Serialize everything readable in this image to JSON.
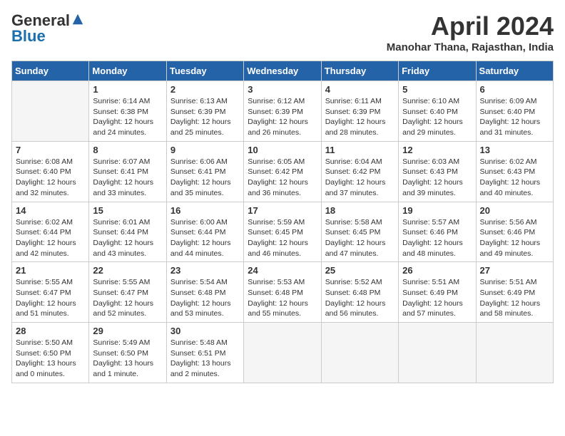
{
  "header": {
    "logo_general": "General",
    "logo_blue": "Blue",
    "month_title": "April 2024",
    "location": "Manohar Thana, Rajasthan, India"
  },
  "weekdays": [
    "Sunday",
    "Monday",
    "Tuesday",
    "Wednesday",
    "Thursday",
    "Friday",
    "Saturday"
  ],
  "weeks": [
    [
      {
        "day": "",
        "content": ""
      },
      {
        "day": "1",
        "content": "Sunrise: 6:14 AM\nSunset: 6:38 PM\nDaylight: 12 hours\nand 24 minutes."
      },
      {
        "day": "2",
        "content": "Sunrise: 6:13 AM\nSunset: 6:39 PM\nDaylight: 12 hours\nand 25 minutes."
      },
      {
        "day": "3",
        "content": "Sunrise: 6:12 AM\nSunset: 6:39 PM\nDaylight: 12 hours\nand 26 minutes."
      },
      {
        "day": "4",
        "content": "Sunrise: 6:11 AM\nSunset: 6:39 PM\nDaylight: 12 hours\nand 28 minutes."
      },
      {
        "day": "5",
        "content": "Sunrise: 6:10 AM\nSunset: 6:40 PM\nDaylight: 12 hours\nand 29 minutes."
      },
      {
        "day": "6",
        "content": "Sunrise: 6:09 AM\nSunset: 6:40 PM\nDaylight: 12 hours\nand 31 minutes."
      }
    ],
    [
      {
        "day": "7",
        "content": "Sunrise: 6:08 AM\nSunset: 6:40 PM\nDaylight: 12 hours\nand 32 minutes."
      },
      {
        "day": "8",
        "content": "Sunrise: 6:07 AM\nSunset: 6:41 PM\nDaylight: 12 hours\nand 33 minutes."
      },
      {
        "day": "9",
        "content": "Sunrise: 6:06 AM\nSunset: 6:41 PM\nDaylight: 12 hours\nand 35 minutes."
      },
      {
        "day": "10",
        "content": "Sunrise: 6:05 AM\nSunset: 6:42 PM\nDaylight: 12 hours\nand 36 minutes."
      },
      {
        "day": "11",
        "content": "Sunrise: 6:04 AM\nSunset: 6:42 PM\nDaylight: 12 hours\nand 37 minutes."
      },
      {
        "day": "12",
        "content": "Sunrise: 6:03 AM\nSunset: 6:43 PM\nDaylight: 12 hours\nand 39 minutes."
      },
      {
        "day": "13",
        "content": "Sunrise: 6:02 AM\nSunset: 6:43 PM\nDaylight: 12 hours\nand 40 minutes."
      }
    ],
    [
      {
        "day": "14",
        "content": "Sunrise: 6:02 AM\nSunset: 6:44 PM\nDaylight: 12 hours\nand 42 minutes."
      },
      {
        "day": "15",
        "content": "Sunrise: 6:01 AM\nSunset: 6:44 PM\nDaylight: 12 hours\nand 43 minutes."
      },
      {
        "day": "16",
        "content": "Sunrise: 6:00 AM\nSunset: 6:44 PM\nDaylight: 12 hours\nand 44 minutes."
      },
      {
        "day": "17",
        "content": "Sunrise: 5:59 AM\nSunset: 6:45 PM\nDaylight: 12 hours\nand 46 minutes."
      },
      {
        "day": "18",
        "content": "Sunrise: 5:58 AM\nSunset: 6:45 PM\nDaylight: 12 hours\nand 47 minutes."
      },
      {
        "day": "19",
        "content": "Sunrise: 5:57 AM\nSunset: 6:46 PM\nDaylight: 12 hours\nand 48 minutes."
      },
      {
        "day": "20",
        "content": "Sunrise: 5:56 AM\nSunset: 6:46 PM\nDaylight: 12 hours\nand 49 minutes."
      }
    ],
    [
      {
        "day": "21",
        "content": "Sunrise: 5:55 AM\nSunset: 6:47 PM\nDaylight: 12 hours\nand 51 minutes."
      },
      {
        "day": "22",
        "content": "Sunrise: 5:55 AM\nSunset: 6:47 PM\nDaylight: 12 hours\nand 52 minutes."
      },
      {
        "day": "23",
        "content": "Sunrise: 5:54 AM\nSunset: 6:48 PM\nDaylight: 12 hours\nand 53 minutes."
      },
      {
        "day": "24",
        "content": "Sunrise: 5:53 AM\nSunset: 6:48 PM\nDaylight: 12 hours\nand 55 minutes."
      },
      {
        "day": "25",
        "content": "Sunrise: 5:52 AM\nSunset: 6:48 PM\nDaylight: 12 hours\nand 56 minutes."
      },
      {
        "day": "26",
        "content": "Sunrise: 5:51 AM\nSunset: 6:49 PM\nDaylight: 12 hours\nand 57 minutes."
      },
      {
        "day": "27",
        "content": "Sunrise: 5:51 AM\nSunset: 6:49 PM\nDaylight: 12 hours\nand 58 minutes."
      }
    ],
    [
      {
        "day": "28",
        "content": "Sunrise: 5:50 AM\nSunset: 6:50 PM\nDaylight: 13 hours\nand 0 minutes."
      },
      {
        "day": "29",
        "content": "Sunrise: 5:49 AM\nSunset: 6:50 PM\nDaylight: 13 hours\nand 1 minute."
      },
      {
        "day": "30",
        "content": "Sunrise: 5:48 AM\nSunset: 6:51 PM\nDaylight: 13 hours\nand 2 minutes."
      },
      {
        "day": "",
        "content": ""
      },
      {
        "day": "",
        "content": ""
      },
      {
        "day": "",
        "content": ""
      },
      {
        "day": "",
        "content": ""
      }
    ]
  ]
}
